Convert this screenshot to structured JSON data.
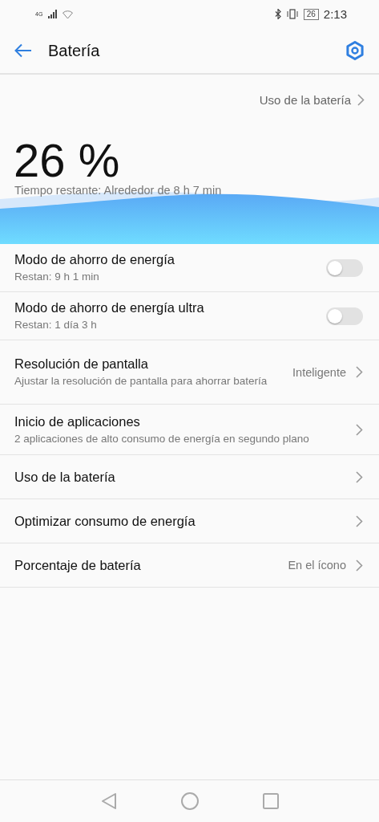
{
  "status_bar": {
    "network": "4G",
    "battery": "26",
    "time": "2:13"
  },
  "header": {
    "title": "Batería"
  },
  "usage_link": "Uso de la batería",
  "level_text": "26 %",
  "remaining": "Tiempo restante: Alrededor de 8 h 7 min",
  "items": [
    {
      "kind": "toggle",
      "title": "Modo de ahorro de energía",
      "subtitle": "Restan: 9 h 1 min",
      "on": false
    },
    {
      "kind": "toggle",
      "title": "Modo de ahorro de energía ultra",
      "subtitle": "Restan: 1 día 3 h",
      "on": false
    },
    {
      "kind": "link",
      "title": "Resolución de pantalla",
      "subtitle": "Ajustar la resolución de pantalla para ahorrar batería",
      "value": "Inteligente"
    },
    {
      "kind": "link",
      "title": "Inicio de aplicaciones",
      "subtitle": "2 aplicaciones de alto consumo de energía en segundo plano"
    },
    {
      "kind": "link",
      "title": "Uso de la batería"
    },
    {
      "kind": "link",
      "title": "Optimizar consumo de energía"
    },
    {
      "kind": "link",
      "title": "Porcentaje de batería",
      "value": "En el ícono"
    }
  ]
}
